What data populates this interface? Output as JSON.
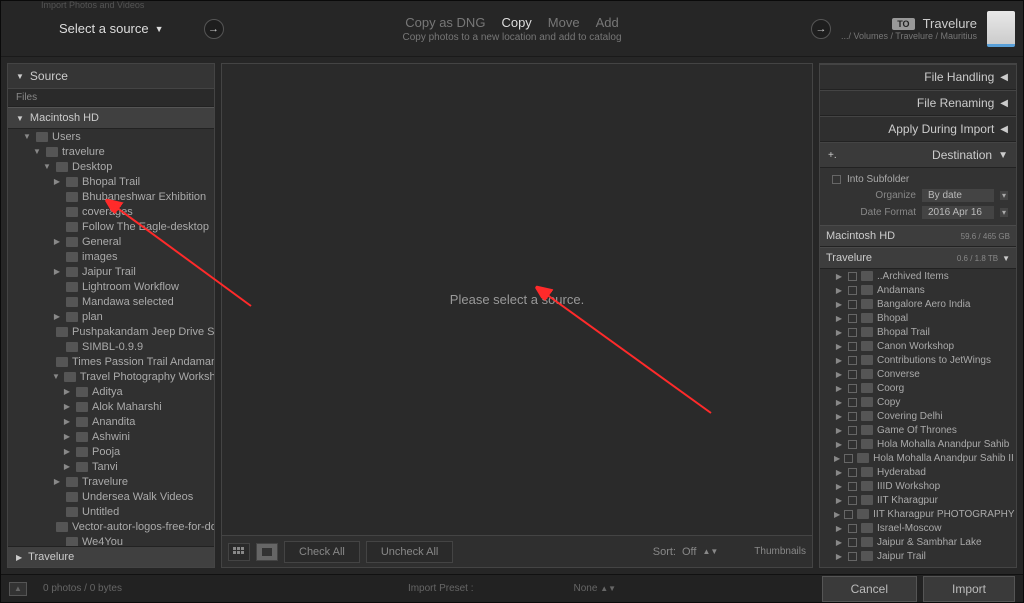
{
  "window_title": "Import Photos and Videos",
  "topbar": {
    "select_source": "Select a source",
    "actions": [
      "Copy as DNG",
      "Copy",
      "Move",
      "Add"
    ],
    "active_action": 1,
    "subtitle": "Copy photos to a new location and add to catalog",
    "to_badge": "TO",
    "dest_name": "Travelure",
    "dest_path": ".../ Volumes / Travelure / Mauritius"
  },
  "left": {
    "source_label": "Source",
    "files_label": "Files",
    "volume": "Macintosh HD",
    "tree": [
      {
        "d": 1,
        "e": true,
        "l": "Users"
      },
      {
        "d": 2,
        "e": true,
        "l": "travelure"
      },
      {
        "d": 3,
        "e": true,
        "l": "Desktop"
      },
      {
        "d": 4,
        "e": false,
        "l": "Bhopal Trail"
      },
      {
        "d": 4,
        "e": null,
        "l": "Bhubaneshwar Exhibition"
      },
      {
        "d": 4,
        "e": null,
        "l": "coverages"
      },
      {
        "d": 4,
        "e": null,
        "l": "Follow The Eagle-desktop"
      },
      {
        "d": 4,
        "e": false,
        "l": "General"
      },
      {
        "d": 4,
        "e": null,
        "l": "images"
      },
      {
        "d": 4,
        "e": false,
        "l": "Jaipur Trail"
      },
      {
        "d": 4,
        "e": null,
        "l": "Lightroom Workflow"
      },
      {
        "d": 4,
        "e": null,
        "l": "Mandawa selected"
      },
      {
        "d": 4,
        "e": false,
        "l": "plan"
      },
      {
        "d": 4,
        "e": null,
        "l": "Pushpakandam Jeep Drive Small..."
      },
      {
        "d": 4,
        "e": null,
        "l": "SIMBL-0.9.9"
      },
      {
        "d": 4,
        "e": null,
        "l": "Times Passion Trail Andamans"
      },
      {
        "d": 4,
        "e": true,
        "l": "Travel Photography Workshop"
      },
      {
        "d": 5,
        "e": false,
        "l": "Aditya"
      },
      {
        "d": 5,
        "e": false,
        "l": "Alok Maharshi"
      },
      {
        "d": 5,
        "e": false,
        "l": "Anandita"
      },
      {
        "d": 5,
        "e": false,
        "l": "Ashwini"
      },
      {
        "d": 5,
        "e": false,
        "l": "Pooja"
      },
      {
        "d": 5,
        "e": false,
        "l": "Tanvi"
      },
      {
        "d": 4,
        "e": false,
        "l": "Travelure"
      },
      {
        "d": 4,
        "e": null,
        "l": "Undersea Walk Videos"
      },
      {
        "d": 4,
        "e": null,
        "l": "Untitled"
      },
      {
        "d": 4,
        "e": null,
        "l": "Vector-autor-logos-free-for-dow..."
      },
      {
        "d": 4,
        "e": null,
        "l": "We4You"
      }
    ],
    "bottom_vol": "Travelure"
  },
  "center": {
    "empty_msg": "Please select a source.",
    "check_all": "Check All",
    "uncheck_all": "Uncheck All",
    "sort_label": "Sort:",
    "sort_value": "Off",
    "thumb_label": "Thumbnails"
  },
  "right": {
    "panels": [
      "File Handling",
      "File Renaming",
      "Apply During Import"
    ],
    "dest_label": "Destination",
    "into_sub": "Into Subfolder",
    "organize_label": "Organize",
    "organize_val": "By date",
    "datefmt_label": "Date Format",
    "datefmt_val": "2016 Apr 16",
    "vol1": {
      "name": "Macintosh HD",
      "size": "59.6 / 465 GB"
    },
    "vol2": {
      "name": "Travelure",
      "size": "0.6 / 1.8 TB"
    },
    "tree": [
      "..Archived Items",
      "Andamans",
      "Bangalore Aero India",
      "Bhopal",
      "Bhopal Trail",
      "Canon Workshop",
      "Contributions to JetWings",
      "Converse",
      "Coorg",
      "Copy",
      "Covering Delhi",
      "Game Of Thrones",
      "Hola Mohalla Anandpur Sahib",
      "Hola Mohalla Anandpur Sahib II",
      "Hyderabad",
      "IIID Workshop",
      "IIT Kharagpur",
      "IIT Kharagpur PHOTOGRAPHY WOR...",
      "Israel-Moscow",
      "Jaipur & Sambhar Lake",
      "Jaipur Trail"
    ]
  },
  "footer": {
    "status": "0 photos / 0 bytes",
    "preset_label": "Import Preset :",
    "preset_val": "None",
    "cancel": "Cancel",
    "import": "Import"
  }
}
